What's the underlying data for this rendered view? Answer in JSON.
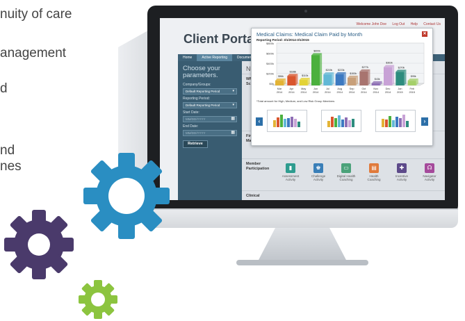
{
  "left_text": [
    "nuity of care",
    "anagement",
    "d",
    "nd",
    "nes"
  ],
  "portal": {
    "title": "Client Portal",
    "topnav": [
      "Welcome John Doe",
      "Log Out",
      "Help",
      "Contact Us"
    ],
    "nav_tabs": [
      "Home",
      "Active Reporting",
      "Documents"
    ]
  },
  "params": {
    "heading_line1": "Choose your",
    "heading_line2": "parameters.",
    "company_label": "Company/Groups:",
    "company_value": "Default Reporting Period",
    "period_label": "Reporting Period:",
    "period_value": "Default Reporting Period",
    "start_label": "Start Date:",
    "start_placeholder": "MM/DD/YYYY",
    "end_label": "End Date:",
    "end_placeholder": "MM/DD/YYYY",
    "retrieve": "Retrieve"
  },
  "main": {
    "next": "Next, cho",
    "rows": [
      {
        "label_1": "WMA",
        "label_2": "Scorecard"
      },
      {
        "label_1": "Financial",
        "label_2": "Managemen"
      },
      {
        "label_1": "Member",
        "label_2": "Participation"
      },
      {
        "label_1": "Clinical",
        "label_2": ""
      }
    ],
    "activities": [
      {
        "line1": "Assessment",
        "line2": "Activity",
        "color": "#2e9c8f"
      },
      {
        "line1": "Challenge",
        "line2": "Activity",
        "color": "#3a7fb8"
      },
      {
        "line1": "Digital Health",
        "line2": "Coaching",
        "color": "#4ba27a"
      },
      {
        "line1": "Health",
        "line2": "Coaching",
        "color": "#e07a3b"
      },
      {
        "line1": "Incentive",
        "line2": "Activity",
        "color": "#5d4a8a"
      },
      {
        "line1": "Navigator",
        "line2": "Activity",
        "color": "#a54a9b"
      }
    ]
  },
  "modal": {
    "title": "Medical Claims: Medical Claim Paid by Month",
    "subtitle": "Reporting Period: 3/1/2014-3/1/2015",
    "close": "✕",
    "footnote": "*Total amount for High, Medium, and Low Risk Group Members",
    "prev": "‹",
    "next": "›"
  },
  "chart_data": {
    "type": "bar",
    "title": "",
    "xlabel": "",
    "ylabel": "",
    "ylim": [
      0,
      800
    ],
    "yticks": [
      "$0k",
      "$200k",
      "$400k",
      "$600k",
      "$800k"
    ],
    "categories": [
      "Mar 2014",
      "Apr 2014",
      "May 2014",
      "Jun 2014",
      "Jul 2014",
      "Aug 2014",
      "Sep 2014",
      "Oct 2014",
      "Nov 2014",
      "Dec 2014",
      "Jan 2015",
      "Feb 2015"
    ],
    "values": [
      96,
      188,
      110,
      600,
      219,
      223,
      153,
      277,
      43,
      363,
      270,
      95
    ],
    "data_labels": [
      "$96k",
      "$188k",
      "$110k",
      "$600k",
      "$219k",
      "$223k",
      "$153k",
      "$277k",
      "$43k",
      "$363k",
      "$270k",
      "$95k"
    ],
    "colors": [
      "#e3b335",
      "#d9562e",
      "#e3d335",
      "#4bb03e",
      "#62b8d6",
      "#3c79c1",
      "#c8a07a",
      "#a8746f",
      "#8e6fb5",
      "#c8a2d6",
      "#2d8c7e",
      "#a5d06a"
    ]
  }
}
